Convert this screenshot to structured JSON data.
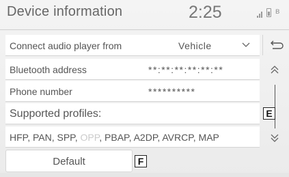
{
  "header": {
    "title": "Device information",
    "clock": "2:25",
    "icons": [
      "signal-icon",
      "battery-icon",
      "bluetooth-icon"
    ]
  },
  "rows": {
    "connect": {
      "label": "Connect audio player from",
      "value": "Vehicle"
    },
    "bluetooth": {
      "label": "Bluetooth address",
      "value": "**:**:**:**:**:**"
    },
    "phone": {
      "label": "Phone number",
      "value": "**********"
    },
    "supported": {
      "label": "Supported profiles:"
    }
  },
  "profiles": {
    "before": "HFP, PAN, SPP, ",
    "disabled": "OPP",
    "after": ", PBAP, A2DP, AVRCP, MAP"
  },
  "buttons": {
    "default_label": "Default",
    "back_icon": "back-arrow-icon",
    "up_icon": "scroll-up-icon",
    "down_icon": "scroll-down-icon"
  },
  "callouts": {
    "e": "E",
    "f": "F"
  },
  "colors": {
    "text": "#555555",
    "disabled_text": "#cbcbcb",
    "row_background": "#ffffff",
    "screen_background": "#eeeeee"
  }
}
